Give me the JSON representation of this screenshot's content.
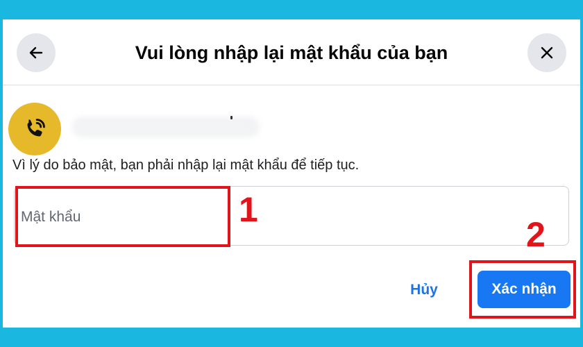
{
  "dialog": {
    "title": "Vui lòng nhập lại mật khẩu của bạn",
    "back_icon": "arrow-left-icon",
    "close_icon": "close-icon"
  },
  "account": {
    "avatar_icon": "phone-call-icon",
    "avatar_color": "#e6b92a"
  },
  "instruction": "Vì lý do bảo mật, bạn phải nhập lại mật khẩu để tiếp tục.",
  "password": {
    "placeholder": "Mật khẩu",
    "value": ""
  },
  "annotations": {
    "step1": "1",
    "step2": "2",
    "color": "#e0141b"
  },
  "buttons": {
    "cancel": "Hủy",
    "confirm": "Xác nhận",
    "confirm_color": "#1877f2"
  },
  "colors": {
    "frame": "#1ab8e0"
  }
}
